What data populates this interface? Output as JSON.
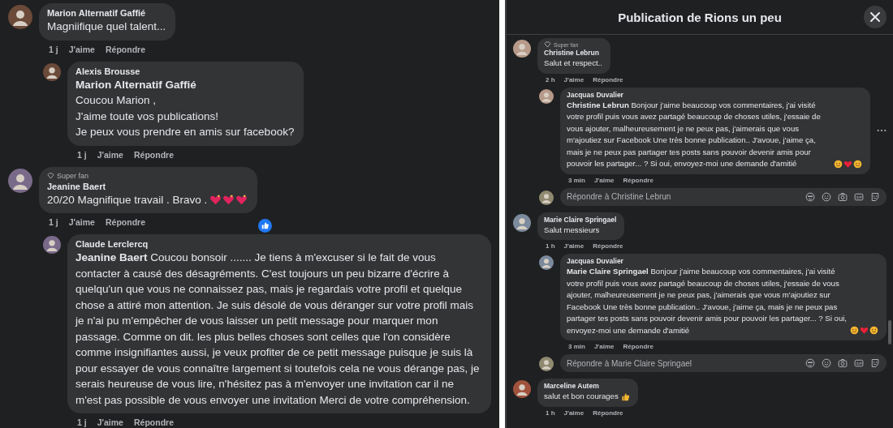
{
  "left": {
    "comments": [
      {
        "author": "Marion Alternatif Gaffié",
        "text": "Magniifique quel talent...",
        "time": "1 j",
        "like": "J'aime",
        "reply": "Répondre",
        "replies": [
          {
            "author": "Alexis Brousse",
            "text": "**Marion Alternatif Gaffié**\nCoucou Marion ,\nJ'aime toute vos publications!\nJe peux vous prendre en amis sur facebook?",
            "time": "1 j",
            "like": "J'aime",
            "reply": "Répondre"
          }
        ]
      },
      {
        "author": "Jeanine Baert",
        "badge": "Super fan",
        "text": "20/20 Magnifique travail . Bravo .",
        "emojis": [
          {
            "kind": "sparkle-heart"
          },
          {
            "kind": "sparkle-heart"
          },
          {
            "kind": "sparkle-heart"
          }
        ],
        "time": "1 j",
        "like": "J'aime",
        "reply": "Répondre",
        "reacted": true,
        "replies": [
          {
            "author": "Claude Lerclercq",
            "text": "**Jeanine Baert** Coucou bonsoir ....... Je tiens à m'excuser si le fait de vous contacter à causé des désagréments. C'est toujours un peu bizarre d'écrire à quelqu'un que vous ne connaissez pas, mais je regardais votre profil et quelque chose a attiré mon attention. Je suis désolé de vous déranger sur votre profil mais je n'ai pu m'empêcher de vous laisser un petit message pour marquer mon passage. Comme on dit. les plus belles choses sont celles que l'on considère comme insignifiantes aussi, je veux profiter de ce petit message puisque je suis là pour essayer de vous connaître largement si toutefois cela ne vous dérange pas, je serais heureuse de vous lire, n'hésitez pas à m'envoyer une invitation car il ne m'est pas possible de vous envoyer une invitation Merci de votre compréhension.",
            "time": "1 j",
            "like": "J'aime",
            "reply": "Répondre"
          }
        ]
      }
    ]
  },
  "dialog": {
    "title": "Publication de Rions un peu",
    "comments": [
      {
        "author": "Christine Lebrun",
        "badge": "Super fan",
        "text": "Salut et respect..",
        "time": "2 h",
        "like": "J'aime",
        "reply": "Répondre",
        "replies": [
          {
            "author": "Jacquas Duvalier",
            "text": "**Christine Lebrun** Bonjour j'aime beaucoup vos commentaires, j'ai visité votre profil puis vous avez partagé beaucoup de choses utiles, j'essaie de vous ajouter, malheureusement je ne peux pas, j'aimerais que vous m'ajoutiez sur Facebook Une très bonne publication.. J'avoue, j'aime ça, mais je ne peux pas partager tes posts sans pouvoir devenir amis pour pouvoir les partager... ? Si oui, envoyez-moi une demande d'amitié",
            "emojis": [
              {
                "kind": "smile"
              },
              {
                "kind": "heart"
              },
              {
                "kind": "smile"
              }
            ],
            "time": "3 min",
            "like": "J'aime",
            "reply": "Répondre",
            "more": true
          }
        ],
        "reply_box": {
          "placeholder": "Répondre à Christine Lebrun"
        }
      },
      {
        "author": "Marie Claire Springael",
        "text": "Salut messieurs",
        "time": "1 h",
        "like": "J'aime",
        "reply": "Répondre",
        "replies": [
          {
            "author": "Jacquas Duvalier",
            "text": "**Marie Claire Springael** Bonjour j'aime beaucoup vos commentaires, j'ai visité votre profil puis vous avez partagé beaucoup de choses utiles, j'essaie de vous ajouter, malheureusement je ne peux pas, j'aimerais que vous m'ajoutiez sur Facebook Une très bonne publication.. J'avoue, j'aime ça, mais je ne peux pas partager tes posts sans pouvoir devenir amis pour pouvoir les partager... ? Si oui, envoyez-moi une demande d'amitié",
            "emojis": [
              {
                "kind": "smile"
              },
              {
                "kind": "heart"
              },
              {
                "kind": "smile"
              }
            ],
            "time": "3 min",
            "like": "J'aime",
            "reply": "Répondre"
          }
        ],
        "reply_box": {
          "placeholder": "Répondre à Marie Claire Springael"
        }
      },
      {
        "author": "Marceline Autem",
        "text": "salut et bon courages",
        "emojis": [
          {
            "kind": "thumbs-up"
          }
        ],
        "time": "1 h",
        "like": "J'aime",
        "reply": "Répondre"
      }
    ]
  }
}
